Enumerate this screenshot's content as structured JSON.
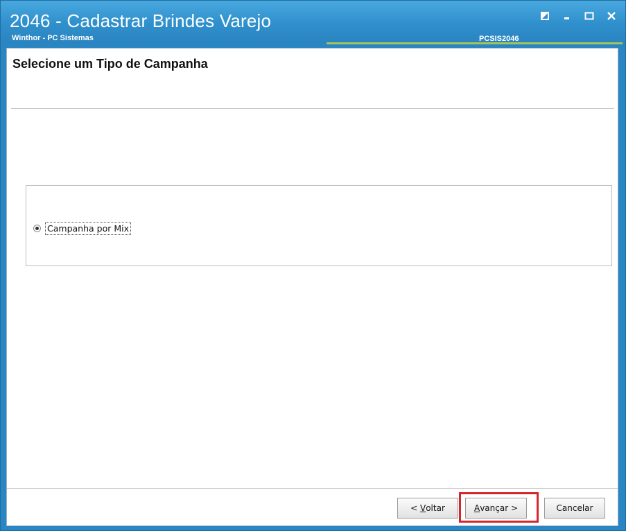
{
  "window": {
    "title": "2046 - Cadastrar Brindes Varejo",
    "subtitle": "Winthor - PC Sistemas",
    "code": "PCSIS2046",
    "controls": [
      "restore-icon",
      "minimize-icon",
      "maximize-icon",
      "close-icon"
    ]
  },
  "page": {
    "title": "Selecione um Tipo de Campanha"
  },
  "options": {
    "campanha_mix": {
      "label": "Campanha por Mix",
      "selected": true
    }
  },
  "buttons": {
    "voltar": {
      "prefix": "< ",
      "mnemonic": "V",
      "rest": "oltar"
    },
    "avancar": {
      "mnemonic": "A",
      "rest": "vançar >"
    },
    "cancelar": {
      "label": "Cancelar"
    }
  },
  "colors": {
    "titlebar": "#2f8fcc",
    "accent_line": "#a5c45a",
    "highlight_frame": "#d7262b"
  }
}
